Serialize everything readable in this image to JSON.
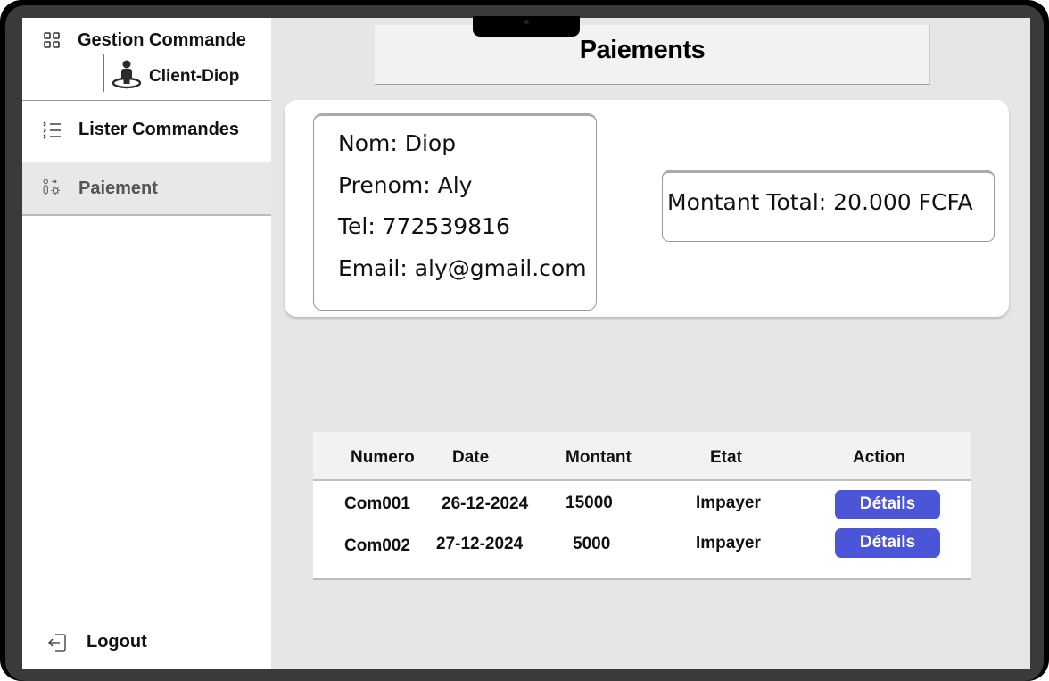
{
  "app": {
    "title": "Gestion Commande",
    "client": "Client-Diop"
  },
  "nav": {
    "items": [
      {
        "label": "Lister Commandes",
        "icon": "list-icon"
      },
      {
        "label": "Paiement",
        "icon": "payment-icon"
      }
    ],
    "logout": "Logout"
  },
  "header": {
    "title": "Paiements"
  },
  "client": {
    "nom": "Nom: Diop",
    "prenom": "Prenom: Aly",
    "tel": "Tel: 772539816",
    "email": "Email: aly@gmail.com"
  },
  "total": "Montant Total: 20.000 FCFA",
  "table": {
    "headers": [
      "Numero",
      "Date",
      "Montant",
      "Etat",
      "Action"
    ],
    "rows": [
      {
        "numero": "Com001",
        "date": "26-12-2024",
        "montant": "15000",
        "etat": "Impayer",
        "action": "Détails"
      },
      {
        "numero": "Com002",
        "date": "27-12-2024",
        "montant": "5000",
        "etat": "Impayer",
        "action": "Détails"
      }
    ]
  },
  "colors": {
    "accent": "#4a55d8",
    "background": "#e6e6e6",
    "frame": "#000000"
  }
}
